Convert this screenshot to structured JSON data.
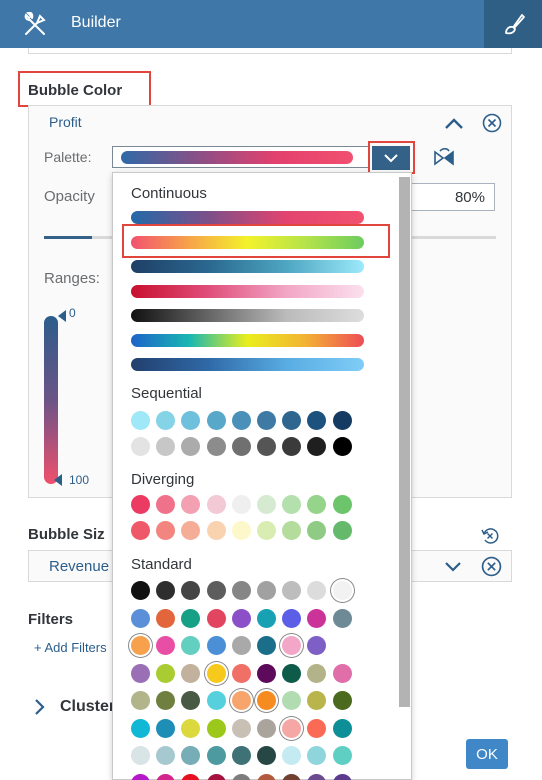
{
  "header": {
    "title": "Builder",
    "tools_icon": "tools-icon",
    "brush_icon": "paint-brush-icon"
  },
  "bubble_color": {
    "title": "Bubble Color",
    "measure": "Profit",
    "palette_label": "Palette:",
    "opacity_label": "Opacity",
    "opacity_value": "80%",
    "opacity_fraction": 0.8,
    "ranges_label": "Ranges:",
    "range_min": "0",
    "range_max": "100"
  },
  "bubble_size": {
    "title": "Bubble Siz",
    "field": "Revenue"
  },
  "filters": {
    "title": "Filters",
    "add_label": "+ Add Filters"
  },
  "clusters": {
    "title": "Cluster"
  },
  "ok_label": "OK",
  "dropdown": {
    "continuous_heading": "Continuous",
    "continuous": [
      [
        "#2369a8",
        "#7d4f89",
        "#e2446f",
        "#f2526f"
      ],
      [
        "#f2526f",
        "#f7a44a",
        "#f3f22b",
        "#b4e34a",
        "#6dcc5f"
      ],
      [
        "#1f3f66",
        "#2a6890",
        "#4ea6c2",
        "#9ce9fa"
      ],
      [
        "#c8102e",
        "#e04e7b",
        "#f2a6c5",
        "#fbe0ee"
      ],
      [
        "#111111",
        "#666666",
        "#bbbbbb",
        "#dddddd"
      ],
      [
        "#1e63c9",
        "#19b7b3",
        "#e9ee1c",
        "#f3b234",
        "#ee4c55"
      ],
      [
        "#223f6e",
        "#2f6aa7",
        "#59ace2",
        "#7fcdf7"
      ]
    ],
    "sequential_heading": "Sequential",
    "sequential": [
      [
        "#9fe8f7",
        "#84d3e7",
        "#6fc0dc",
        "#58a8ca",
        "#4a90b8",
        "#3e7aa3",
        "#2f6690",
        "#1e527e",
        "#153b63"
      ],
      [
        "#e3e3e3",
        "#c7c7c7",
        "#ababab",
        "#8c8c8c",
        "#707070",
        "#555555",
        "#3b3b3b",
        "#1f1f1f",
        "#000000"
      ]
    ],
    "diverging_heading": "Diverging",
    "diverging": [
      [
        "#ec3b63",
        "#f0718a",
        "#f3a0b2",
        "#f2c9d4",
        "#efefef",
        "#d5ead1",
        "#b4e0ad",
        "#95d48a",
        "#6cc56a"
      ],
      [
        "#ef5868",
        "#f2857f",
        "#f5ad97",
        "#f9d3b0",
        "#fdf8ca",
        "#d9edb3",
        "#b4dc9c",
        "#8fcb84",
        "#64b96a"
      ]
    ],
    "standard_heading": "Standard",
    "standard": [
      [
        "#111111",
        "#2e2e2e",
        "#454545",
        "#5d5d5d",
        "#868686",
        "#a1a1a1",
        "#bdbdbd",
        "#dcdcdc",
        "#f2f2f2"
      ],
      [
        "#5b8fd8",
        "#e2653c",
        "#16a085",
        "#e24560",
        "#8b4fc7",
        "#17a1b3",
        "#5b5fe8",
        "#cc3399",
        "#6e8a96"
      ],
      [
        "#f7a14c",
        "#e94ea5",
        "#63cfc0",
        "#4b8fd6",
        "#a9a9a9",
        "#1a6e8a",
        "#f3a7c8",
        "#7e5fc6"
      ],
      [
        "#9b6fb5",
        "#aacc33",
        "#c1b19d",
        "#f7c91c",
        "#f07067",
        "#5d0a5a",
        "#0f5b4a",
        "#b3b38a",
        "#e06ea8"
      ],
      [
        "#b2b48a",
        "#6f7f3f",
        "#485a43",
        "#57d0dd",
        "#f7a56c",
        "#f68b1f",
        "#b1dcb1",
        "#b9b44c",
        "#4b6a1d"
      ],
      [
        "#10b8d6",
        "#1e8eb7",
        "#dbd93e",
        "#9bc81a",
        "#c8c0b4",
        "#aba49d",
        "#f5a7a5",
        "#fa6a55",
        "#0e8e96"
      ],
      [
        "#d9e4e6",
        "#a6c9cf",
        "#76adb6",
        "#4e9aa1",
        "#3f7276",
        "#274744",
        "#c4ebf2",
        "#8ed6db",
        "#5fcfc4"
      ],
      [
        "#b319c8",
        "#d2268c",
        "#e60f1f",
        "#a5123f",
        "#7e7d7d",
        "#b25a3d",
        "#704131",
        "#6b4b90",
        "#5d3a8e"
      ]
    ]
  }
}
